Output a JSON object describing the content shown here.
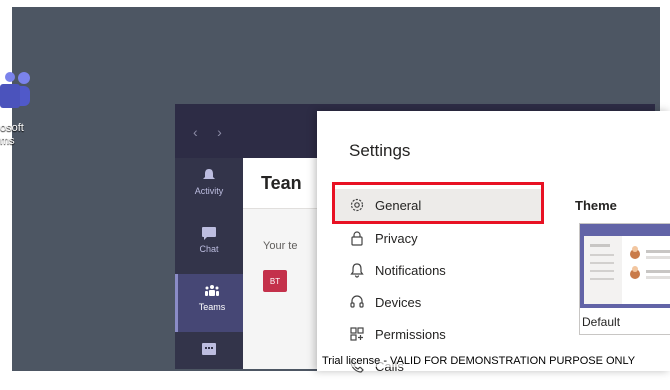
{
  "desktop": {
    "icon_label_line1": "osoft",
    "icon_label_line2": "ms"
  },
  "teams_window": {
    "nav_back": "‹",
    "nav_forward": "›",
    "header_title": "Tean",
    "your_teams_text": "Your te",
    "team_badge": "BT",
    "rail": [
      {
        "label": "Activity",
        "icon": "bell-icon"
      },
      {
        "label": "Chat",
        "icon": "chat-icon"
      },
      {
        "label": "Teams",
        "icon": "teams-icon",
        "active": true
      },
      {
        "label": "",
        "icon": "calendar-icon"
      }
    ]
  },
  "settings": {
    "title": "Settings",
    "menu": [
      {
        "label": "General",
        "icon": "gear-icon",
        "selected": true
      },
      {
        "label": "Privacy",
        "icon": "lock-icon"
      },
      {
        "label": "Notifications",
        "icon": "bell-icon"
      },
      {
        "label": "Devices",
        "icon": "headset-icon"
      },
      {
        "label": "Permissions",
        "icon": "permissions-icon"
      },
      {
        "label": "Calls",
        "icon": "phone-icon"
      }
    ],
    "theme_heading": "Theme",
    "theme_option_label": "Default"
  },
  "watermark": "Trial license - VALID FOR DEMONSTRATION PURPOSE ONLY",
  "colors": {
    "desktop_bg": "#4d5663",
    "teams_rail": "#33344a",
    "teams_accent": "#6264a7",
    "highlight_red": "#e81123"
  }
}
